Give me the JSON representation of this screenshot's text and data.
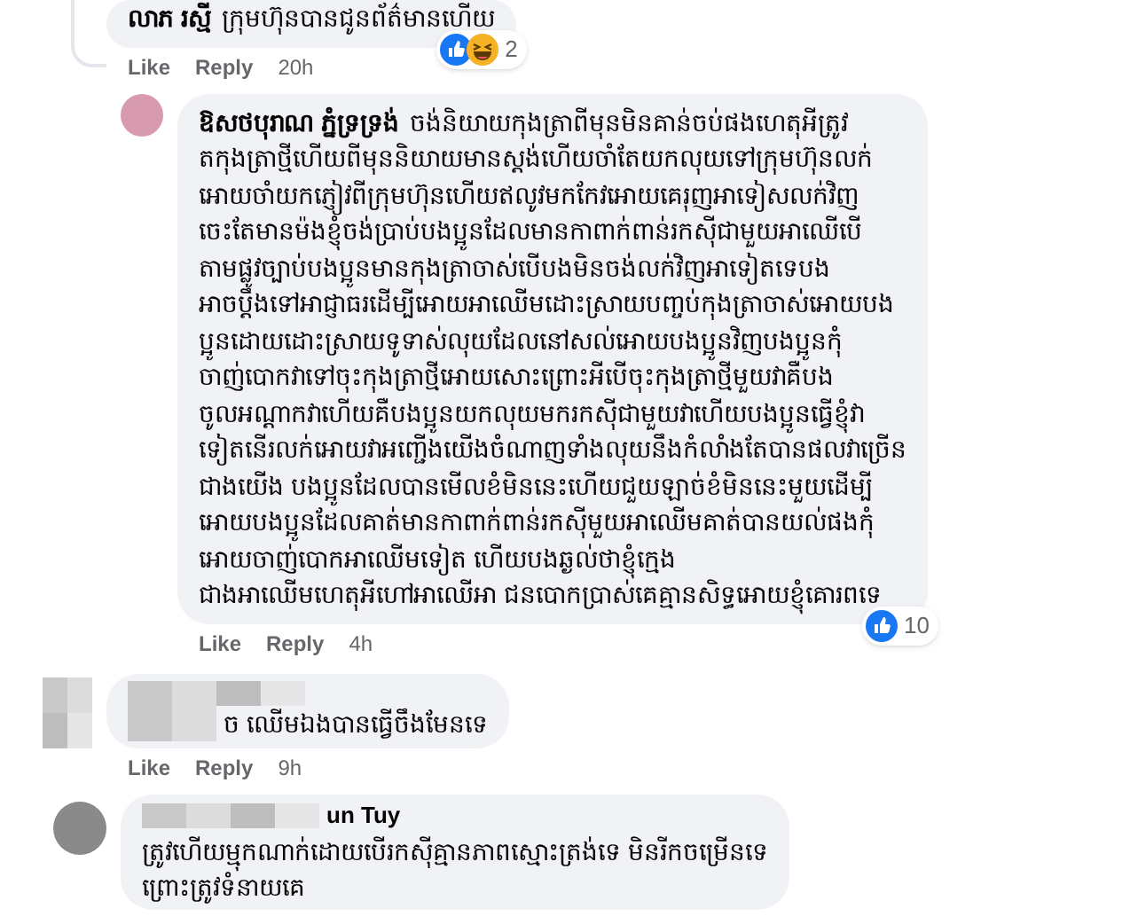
{
  "comments": [
    {
      "author": "លាភ រស្មី",
      "lines": [
        "ក្រុមហ៊ុនបានជូនព័ត៌មានហើយ"
      ],
      "actions": [
        "Like",
        "Reply"
      ],
      "time": "20h",
      "reactions": [
        {
          "kind": "like"
        },
        {
          "kind": "haha"
        }
      ],
      "reaction_count": "2"
    },
    {
      "author": "ឱសថបុរាណ ភ្នំទ្រទ្រង់",
      "lines": [
        "ចង់និយាយកុងត្រាពីមុនមិនគាន់ចប់ផងហេតុអីត្រូវ",
        "តកុងត្រាថ្មីហើយពីមុននិយាយមានស្តង់ហើយចាំតែយកលុយទៅក្រុមហ៊ុនលក់",
        "អោយចាំយកភ្ញៀវពីក្រុមហ៊ុនហើយឥលូវមកកែវអោយគេរុញអាទៀសលក់វិញ",
        "ចេះតែមានម៉ងខ្ញុំចង់ប្រាប់បងប្អូនដែលមានកាពាក់ពាន់រកស៊ីជាមួយអាឈើបើ",
        "តាមផ្លូវច្បាប់បងប្អូនមានកុងត្រាចាស់បើបងមិនចង់លក់វិញអាទៀតទេបង",
        "អាចប្តឹងទៅអាជ្ញាធរដើម្បីអោយអាឈើមដោះស្រាយបញ្ចប់កុងត្រាចាស់អោយបង",
        "ប្អូនដោយដោះស្រាយទូទាស់លុយដែលនៅសល់អោយបងប្អូនវិញបងប្អូនកុំ",
        "ចាញ់បោកវាទៅចុះកុងត្រាថ្មីអោយសោះព្រោះអីបើចុះកុងត្រាថ្មីមួយវាគឺបង",
        "ចូលអណ្តាកវាហើយគឺបងប្អូនយកលុយមករកស៊ីជាមួយវាហើយបងប្អូនធ្វើខ្ញុំវា",
        "ទៀតនើរលក់អោយវាអញ្ជើងយើងចំណាញទាំងលុយនឹងកំលាំងតែបានផលវាច្រើន",
        "ជាងយើង បងប្អូនដែលបានមើលខំមិននេះហើយជួយឡាច់ខំមិននេះមួយដើម្បី",
        "អោយបងប្អូនដែលគាត់មានកាពាក់ពាន់រកស៊ីមួយអាឈើមគាត់បានយល់ផងកុំ",
        "អោយចាញ់បោកអាឈើមទៀត ហើយបងឆ្ងល់ថាខ្ញុំក្មេង",
        "ជាងអាឈើមហេតុអីហៅអាឈើអា ជនបោកប្រាស់គេគ្មានសិទ្ធអោយខ្ញុំគោរពទេ"
      ],
      "actions": [
        "Like",
        "Reply"
      ],
      "time": "4h",
      "reactions": [
        {
          "kind": "like"
        }
      ],
      "reaction_count": "10"
    },
    {
      "lines": [
        "ច ឈើមឯងបានធ្វើចឹងមែនទេ"
      ],
      "actions": [
        "Like",
        "Reply"
      ],
      "time": "9h"
    },
    {
      "author": "un Tuy",
      "lines": [
        "ត្រូវហើយម្មុកណាក់ដោយបើរកស៊ីគ្មានភាពស្មោះត្រង់ទេ មិនរីកចម្រើនទេ",
        "ព្រោះត្រូវទំនាយគេ"
      ]
    }
  ]
}
